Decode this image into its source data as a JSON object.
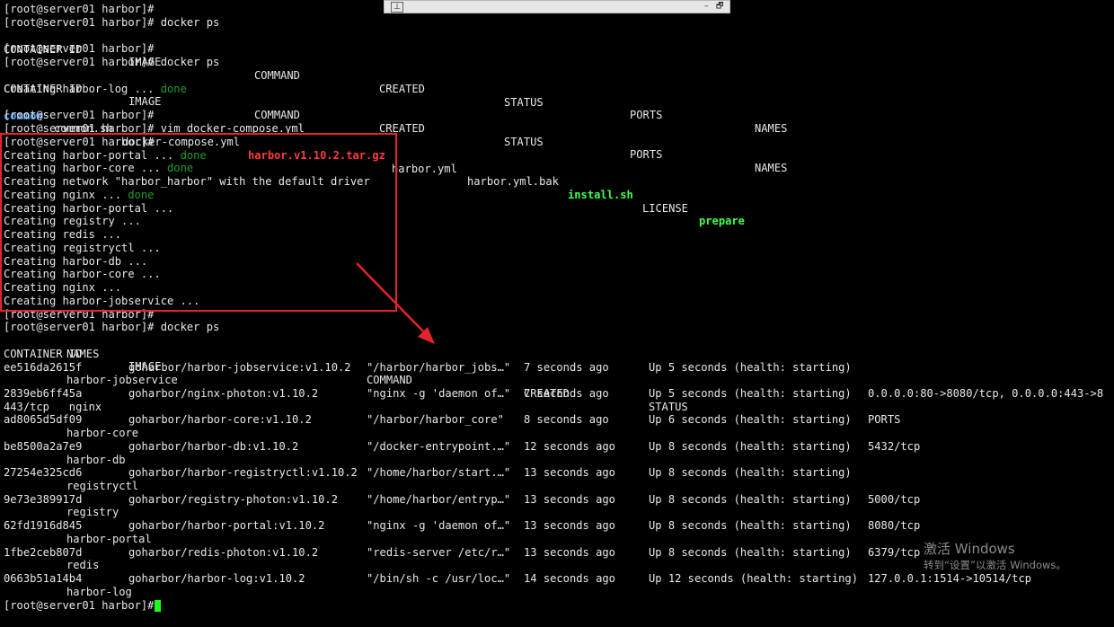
{
  "window": {
    "pin_glyph": "⊥",
    "minimize_glyph": "–",
    "restore_glyph": "🗗"
  },
  "lines": [
    "[root@server01 harbor]#",
    "[root@server01 harbor]# docker ps",
    "",
    "[root@server01 harbor]#",
    "[root@server01 harbor]# docker ps",
    "",
    "",
    "",
    "[root@server01 harbor]#",
    "[root@server01 harbor]# vim docker-compose.yml",
    "[root@server01 harbor]#",
    "",
    "",
    "Creating network \"harbor_harbor\" with the default driver",
    "",
    "Creating harbor-portal ...",
    "Creating registry ...",
    "Creating redis ...",
    "Creating registryctl ...",
    "Creating harbor-db ...",
    "Creating harbor-core ...",
    "Creating nginx ...",
    "Creating harbor-jobservice ...",
    "[root@server01 harbor]#",
    "[root@server01 harbor]# docker ps"
  ],
  "ps_header_short": [
    "CONTAINER ID",
    "IMAGE",
    "COMMAND",
    "CREATED",
    "STATUS",
    "PORTS",
    "NAMES"
  ],
  "creating_done": [
    {
      "text": "Creating harbor-log ... ",
      "status": "done"
    },
    {
      "text": "Creating harbor-portal ... ",
      "status": "done"
    },
    {
      "text": "Creating harbor-core ... ",
      "status": "done"
    },
    {
      "text": "Creating nginx ... ",
      "status": "done"
    }
  ],
  "ls": {
    "common": "common",
    "common_sh": "common.sh",
    "compose": "docker-compose.yml",
    "tarball": "harbor.v1.10.2.tar.gz",
    "harbor_yml": "harbor.yml",
    "harbor_bak": "harbor.yml.bak",
    "install": "install.sh",
    "license": "LICENSE",
    "prepare": "prepare"
  },
  "ps_header": {
    "id": "CONTAINER ID",
    "image": "IMAGE",
    "command": "COMMAND",
    "created": "CREATED",
    "status": "STATUS",
    "ports": "PORTS",
    "names": "NAMES"
  },
  "containers": [
    {
      "id": "ee516da2615f",
      "image": "goharbor/harbor-jobservice:v1.10.2",
      "command": "\"/harbor/harbor_jobs…\"",
      "created": "7 seconds ago",
      "status": "Up 5 seconds (health: starting)",
      "ports": "",
      "name": "harbor-jobservice"
    },
    {
      "id": "2839eb6ff45a",
      "image": "goharbor/nginx-photon:v1.10.2",
      "command": "\"nginx -g 'daemon of…\"",
      "created": "7 seconds ago",
      "status": "Up 5 seconds (health: starting)",
      "ports": "0.0.0.0:80->8080/tcp, 0.0.0.0:443->8",
      "name": "443/tcp   nginx"
    },
    {
      "id": "ad8065d5df09",
      "image": "goharbor/harbor-core:v1.10.2",
      "command": "\"/harbor/harbor_core\"",
      "created": "8 seconds ago",
      "status": "Up 6 seconds (health: starting)",
      "ports": "",
      "name": "harbor-core"
    },
    {
      "id": "be8500a2a7e9",
      "image": "goharbor/harbor-db:v1.10.2",
      "command": "\"/docker-entrypoint.…\"",
      "created": "12 seconds ago",
      "status": "Up 8 seconds (health: starting)",
      "ports": "5432/tcp",
      "name": "harbor-db"
    },
    {
      "id": "27254e325cd6",
      "image": "goharbor/harbor-registryctl:v1.10.2",
      "command": "\"/home/harbor/start.…\"",
      "created": "13 seconds ago",
      "status": "Up 8 seconds (health: starting)",
      "ports": "",
      "name": "registryctl"
    },
    {
      "id": "9e73e389917d",
      "image": "goharbor/registry-photon:v1.10.2",
      "command": "\"/home/harbor/entryp…\"",
      "created": "13 seconds ago",
      "status": "Up 8 seconds (health: starting)",
      "ports": "5000/tcp",
      "name": "registry"
    },
    {
      "id": "62fd1916d845",
      "image": "goharbor/harbor-portal:v1.10.2",
      "command": "\"nginx -g 'daemon of…\"",
      "created": "13 seconds ago",
      "status": "Up 8 seconds (health: starting)",
      "ports": "8080/tcp",
      "name": "harbor-portal"
    },
    {
      "id": "1fbe2ceb807d",
      "image": "goharbor/redis-photon:v1.10.2",
      "command": "\"redis-server /etc/r…\"",
      "created": "13 seconds ago",
      "status": "Up 8 seconds (health: starting)",
      "ports": "6379/tcp",
      "name": "redis"
    },
    {
      "id": "0663b51a14b4",
      "image": "goharbor/harbor-log:v1.10.2",
      "command": "\"/bin/sh -c /usr/loc…\"",
      "created": "14 seconds ago",
      "status": "Up 12 seconds (health: starting)",
      "ports": "127.0.0.1:1514->10514/tcp",
      "name": "harbor-log"
    }
  ],
  "final_prompt": "[root@server01 harbor]# ",
  "watermark": {
    "title": "激活 Windows",
    "subtitle": "转到“设置”以激活 Windows。"
  }
}
